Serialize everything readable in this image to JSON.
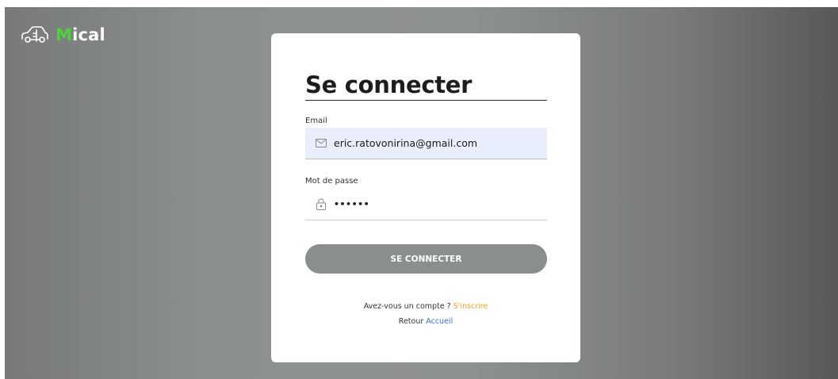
{
  "brand": {
    "name_first_letter": "M",
    "name_rest": "ical"
  },
  "form": {
    "title": "Se connecter",
    "email": {
      "label": "Email",
      "value": "eric.ratovonirina@gmail.com"
    },
    "password": {
      "label": "Mot de passe",
      "value": "••••••"
    },
    "submit_label": "SE CONNECTER"
  },
  "footer": {
    "account_question": "Avez-vous un compte ?",
    "signup_link": "S'inscrire",
    "back_prefix": "Retour",
    "home_link": "Accueil"
  },
  "colors": {
    "brand_accent": "#4fd13b",
    "signup_link": "#f2a31c",
    "home_link": "#3b6fc4",
    "button": "#8b8e8e",
    "email_field_bg": "#e8eefb"
  },
  "icons": {
    "logo": "car-icon",
    "email": "envelope-icon",
    "password": "lock-icon"
  }
}
